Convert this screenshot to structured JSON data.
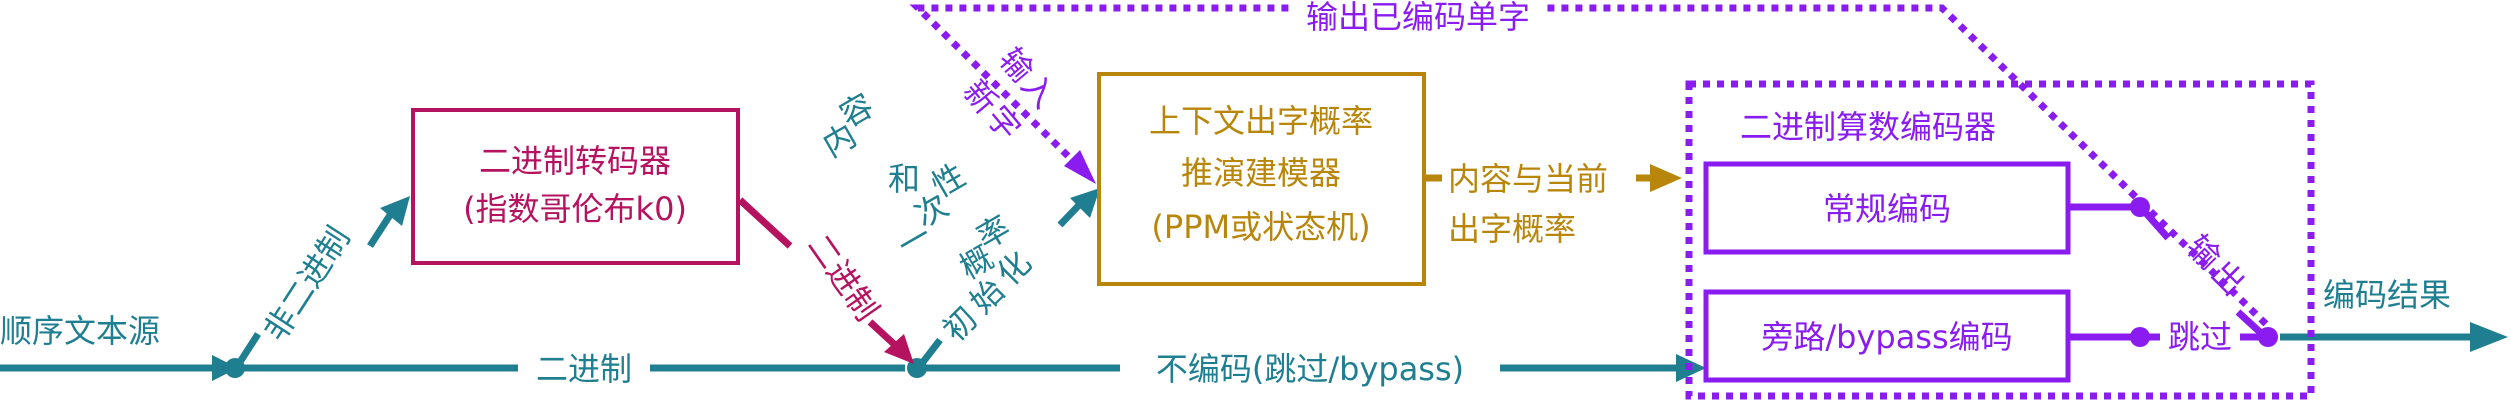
{
  "colors": {
    "teal": "#1f7f91",
    "magenta": "#b5135f",
    "gold": "#b8860b",
    "purple": "#8a1cf0"
  },
  "labels": {
    "source": "顺序文本源",
    "non_binary": "非二进制",
    "binary_main": "二进制",
    "binary_side": "二进制",
    "no_encode": "不编码(跳过/bypass)",
    "init_chars": [
      "初",
      "始",
      "化"
    ],
    "content_col1": [
      "内",
      "容"
    ],
    "content_col2": [
      "和"
    ],
    "content_col3": [
      "一",
      "次",
      "性"
    ],
    "content_col4": [
      "概",
      "率"
    ],
    "input_col1": [
      "输",
      "入"
    ],
    "input_col2": [
      "新",
      "字"
    ],
    "output_coded": "输出已编码单字",
    "prob_line1": "内容与当前",
    "prob_line2": "出字概率",
    "output_chars": [
      "输",
      "出"
    ],
    "skip": "跳过",
    "result": "编码结果"
  },
  "boxes": {
    "binarizer_line1": "二进制转码器",
    "binarizer_line2": "(指数哥伦布k0)",
    "model_line1": "上下文出字概率",
    "model_line2": "推演建模器",
    "model_line3": "(PPM或状态机)",
    "arith_title": "二进制算数编码器",
    "regular": "常规编码",
    "bypass": "旁路/bypass编码"
  }
}
